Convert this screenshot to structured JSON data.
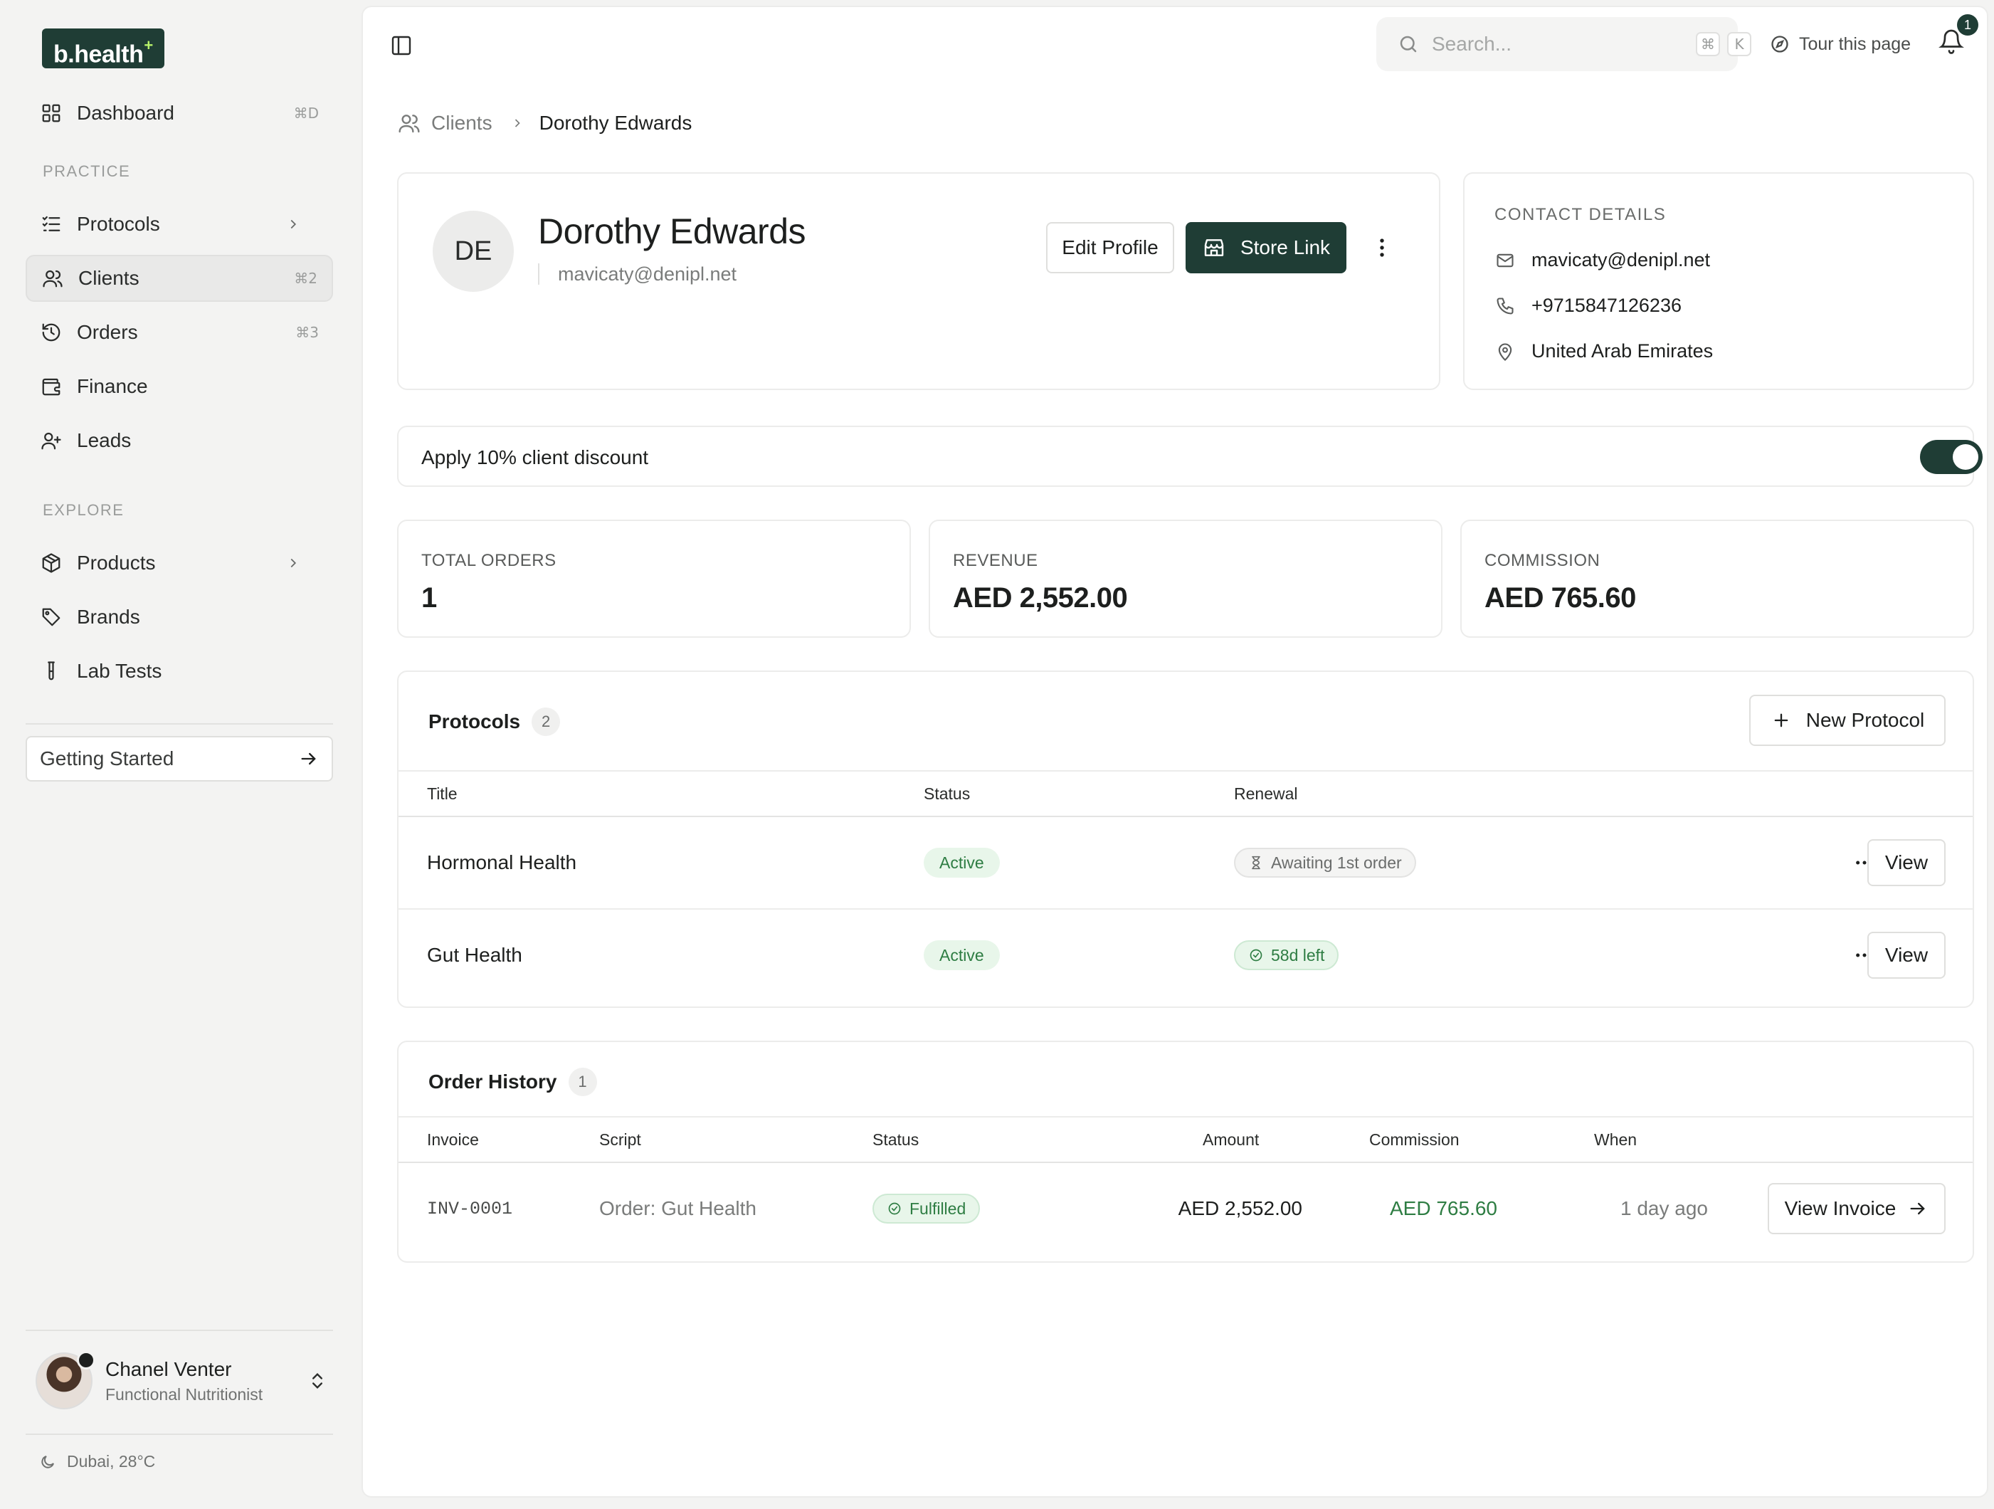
{
  "brand": {
    "logo_text": "b.health",
    "logo_mark": "+"
  },
  "sidebar": {
    "items": [
      {
        "label": "Dashboard",
        "icon": "grid-icon",
        "shortcut": "⌘D"
      },
      {
        "label": "Protocols",
        "icon": "list-check-icon",
        "chevron": true
      },
      {
        "label": "Clients",
        "icon": "users-icon",
        "shortcut": "⌘2",
        "active": true
      },
      {
        "label": "Orders",
        "icon": "history-icon",
        "shortcut": "⌘3"
      },
      {
        "label": "Finance",
        "icon": "wallet-icon"
      },
      {
        "label": "Leads",
        "icon": "user-plus-icon"
      },
      {
        "label": "Products",
        "icon": "package-icon",
        "chevron": true
      },
      {
        "label": "Brands",
        "icon": "tag-icon"
      },
      {
        "label": "Lab Tests",
        "icon": "test-tube-icon"
      }
    ],
    "sections": {
      "practice": "PRACTICE",
      "explore": "EXPLORE"
    },
    "getting_started": "Getting Started",
    "user": {
      "name": "Chanel Venter",
      "role": "Functional Nutritionist"
    },
    "weather": "Dubai, 28°C"
  },
  "topbar": {
    "search_placeholder": "Search...",
    "search_kbd": [
      "⌘",
      "K"
    ],
    "tour": "Tour this page",
    "notification_count": "1"
  },
  "breadcrumb": {
    "parent": "Clients",
    "current": "Dorothy Edwards"
  },
  "profile": {
    "initials": "DE",
    "name": "Dorothy Edwards",
    "email": "mavicaty@denipl.net",
    "edit_label": "Edit Profile",
    "store_label": "Store Link"
  },
  "contact": {
    "title": "CONTACT DETAILS",
    "email": "mavicaty@denipl.net",
    "phone": "+9715847126236",
    "location": "United Arab Emirates"
  },
  "discount": {
    "label": "Apply 10% client discount",
    "enabled": true
  },
  "stats": [
    {
      "label": "TOTAL ORDERS",
      "value": "1"
    },
    {
      "label": "REVENUE",
      "value": "AED 2,552.00"
    },
    {
      "label": "COMMISSION",
      "value": "AED 765.60"
    }
  ],
  "protocols": {
    "title": "Protocols",
    "count": "2",
    "new_label": "New Protocol",
    "columns": [
      "Title",
      "Status",
      "Renewal"
    ],
    "rows": [
      {
        "title": "Hormonal Health",
        "status": "Active",
        "renewal": "Awaiting 1st order",
        "renewal_type": "pending",
        "view": "View"
      },
      {
        "title": "Gut Health",
        "status": "Active",
        "renewal": "58d left",
        "renewal_type": "ok",
        "view": "View"
      }
    ]
  },
  "orders": {
    "title": "Order History",
    "count": "1",
    "columns": [
      "Invoice",
      "Script",
      "Status",
      "Amount",
      "Commission",
      "When"
    ],
    "rows": [
      {
        "invoice": "INV-0001",
        "script": "Order: Gut Health",
        "status": "Fulfilled",
        "amount": "AED 2,552.00",
        "commission": "AED 765.60",
        "when": "1 day ago",
        "action": "View Invoice"
      }
    ]
  },
  "colors": {
    "brand_dark": "#1f3d35",
    "accent_green": "#2e7d43",
    "logo_plus": "#b8f36b"
  }
}
